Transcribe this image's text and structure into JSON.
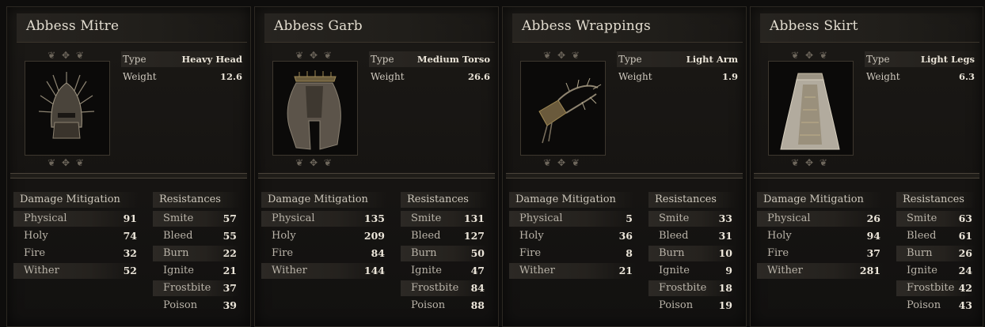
{
  "labels": {
    "type": "Type",
    "weight": "Weight",
    "damage_mitigation": "Damage Mitigation",
    "resistances": "Resistances",
    "physical": "Physical",
    "holy": "Holy",
    "fire": "Fire",
    "wither": "Wither",
    "smite": "Smite",
    "bleed": "Bleed",
    "burn": "Burn",
    "ignite": "Ignite",
    "frostbite": "Frostbite",
    "poison": "Poison"
  },
  "cards": [
    {
      "name": "Abbess Mitre",
      "type": "Heavy Head",
      "weight": "12.6",
      "icon": "helmet-icon",
      "mitigation": {
        "physical": "91",
        "holy": "74",
        "fire": "32",
        "wither": "52"
      },
      "resistances": {
        "smite": "57",
        "bleed": "55",
        "burn": "22",
        "ignite": "21",
        "frostbite": "37",
        "poison": "39"
      }
    },
    {
      "name": "Abbess Garb",
      "type": "Medium Torso",
      "weight": "26.6",
      "icon": "robe-icon",
      "mitigation": {
        "physical": "135",
        "holy": "209",
        "fire": "84",
        "wither": "144"
      },
      "resistances": {
        "smite": "131",
        "bleed": "127",
        "burn": "50",
        "ignite": "47",
        "frostbite": "84",
        "poison": "88"
      }
    },
    {
      "name": "Abbess Wrappings",
      "type": "Light Arm",
      "weight": "1.9",
      "icon": "gauntlet-icon",
      "mitigation": {
        "physical": "5",
        "holy": "36",
        "fire": "8",
        "wither": "21"
      },
      "resistances": {
        "smite": "33",
        "bleed": "31",
        "burn": "10",
        "ignite": "9",
        "frostbite": "18",
        "poison": "19"
      }
    },
    {
      "name": "Abbess Skirt",
      "type": "Light Legs",
      "weight": "6.3",
      "icon": "skirt-icon",
      "mitigation": {
        "physical": "26",
        "holy": "94",
        "fire": "37",
        "wither": "281"
      },
      "resistances": {
        "smite": "63",
        "bleed": "61",
        "burn": "26",
        "ignite": "24",
        "frostbite": "42",
        "poison": "43"
      }
    }
  ]
}
